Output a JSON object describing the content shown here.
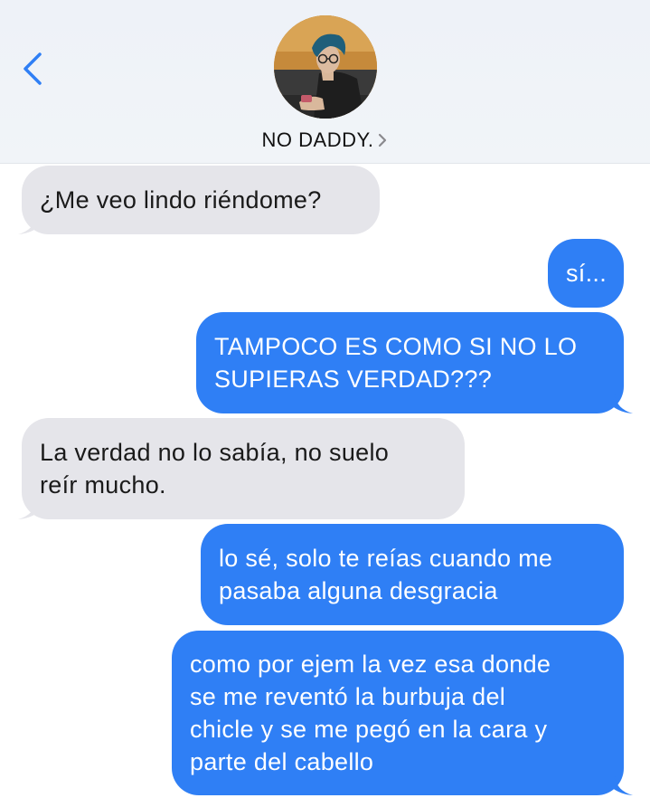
{
  "header": {
    "contact_name": "NO DADDY.",
    "back_icon": "chevron-left-icon",
    "disclosure_icon": "chevron-right-icon",
    "accent_color": "#2f7ff5"
  },
  "messages": [
    {
      "direction": "received",
      "text": "¿Me veo lindo riéndome?"
    },
    {
      "direction": "sent",
      "text": "sí..."
    },
    {
      "direction": "sent",
      "text": "TAMPOCO ES COMO SI NO LO\nSUPIERAS VERDAD???"
    },
    {
      "direction": "received",
      "text": "La verdad no lo sabía, no suelo\nreír mucho."
    },
    {
      "direction": "sent",
      "text": "lo sé, solo te reías cuando me\npasaba alguna desgracia"
    },
    {
      "direction": "sent",
      "text": "como por ejem la vez esa donde\nse me reventó la burbuja del\nchicle y se me pegó en la cara y\nparte del cabello"
    }
  ],
  "colors": {
    "received_bubble": "#e5e5ea",
    "sent_bubble": "#2f7ff5",
    "header_bg": "#eef2f8"
  }
}
